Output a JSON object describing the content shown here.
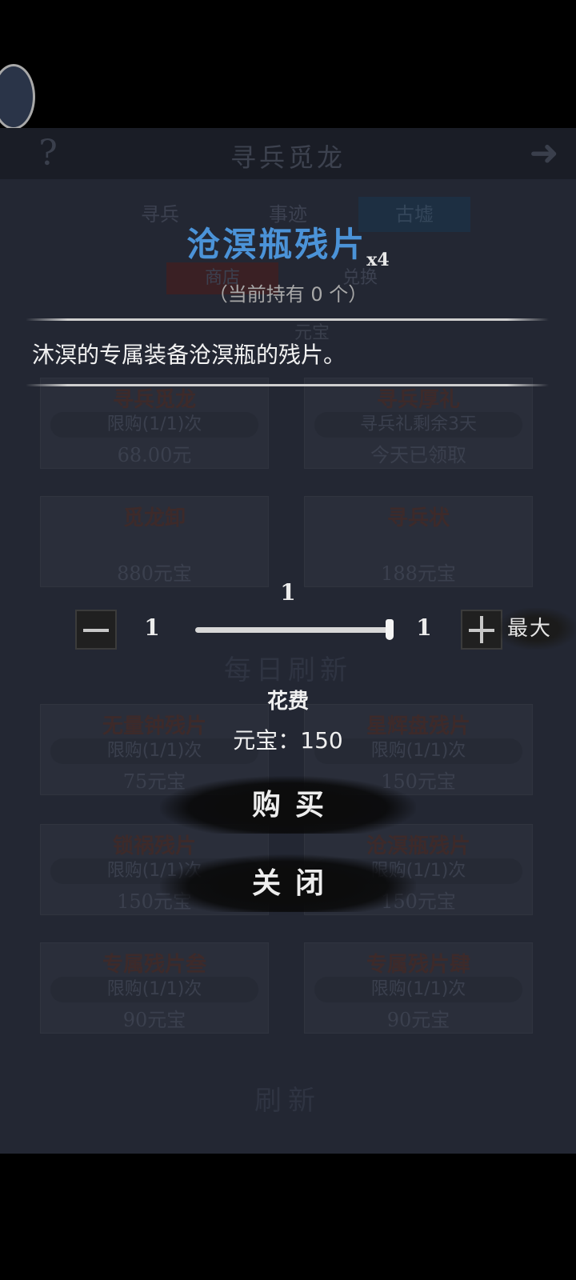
{
  "shop": {
    "title": "寻兵觅龙",
    "help_icon": "question-icon",
    "exit_icon": "arrow-right-icon",
    "tabs": [
      {
        "label": "寻兵",
        "selected": false
      },
      {
        "label": "事迹",
        "selected": false
      },
      {
        "label": "古墟",
        "selected": true
      }
    ],
    "subtabs": [
      {
        "label": "商店",
        "selected": true
      },
      {
        "label": "兑换",
        "selected": false
      }
    ],
    "currency_label": "元宝",
    "cards_top": [
      {
        "name": "寻兵觅龙",
        "limit": "限购(1/1)次",
        "price": "68.00元"
      },
      {
        "name": "寻兵厚礼",
        "limit": "寻兵礼剩余3天",
        "price": "今天已领取"
      },
      {
        "name": "觅龙卸",
        "limit": "",
        "price": "880元宝"
      },
      {
        "name": "寻兵状",
        "limit": "",
        "price": "188元宝"
      }
    ],
    "section_daily": "每日刷新",
    "cards_daily": [
      {
        "name": "无量钟残片",
        "limit": "限购(1/1)次",
        "price": "75元宝"
      },
      {
        "name": "星辉盘残片",
        "limit": "限购(1/1)次",
        "price": "150元宝"
      },
      {
        "name": "锁祸残片",
        "limit": "限购(1/1)次",
        "price": "150元宝"
      },
      {
        "name": "沧溟瓶残片",
        "limit": "限购(1/1)次",
        "price": "150元宝"
      },
      {
        "name": "专属残片叁",
        "limit": "限购(1/1)次",
        "price": "90元宝"
      },
      {
        "name": "专属残片肆",
        "limit": "限购(1/1)次",
        "price": "90元宝"
      }
    ],
    "refresh_label": "刷新"
  },
  "popup": {
    "item_name": "沧溟瓶残片",
    "bundle_count": "x4",
    "holding": "（当前持有 0 个）",
    "description": "沐溟的专属装备沧溟瓶的残片。",
    "quantity": "1",
    "slider": {
      "min": "1",
      "max": "1",
      "value": 1
    },
    "max_label": "最大",
    "cost_label": "花费",
    "cost_value": "元宝：150",
    "buy_label": "购买",
    "close_label": "关闭"
  }
}
